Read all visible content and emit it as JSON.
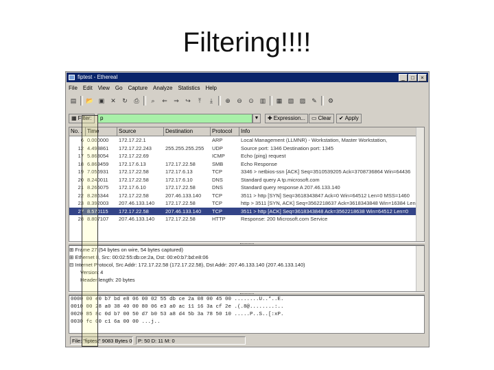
{
  "slide": {
    "title": "Filtering!!!!"
  },
  "window": {
    "title": "fiptest - Ethereal",
    "controls": [
      "_",
      "□",
      "×"
    ]
  },
  "menu": [
    "File",
    "Edit",
    "View",
    "Go",
    "Capture",
    "Analyze",
    "Statistics",
    "Help"
  ],
  "filter": {
    "label": "Filter:",
    "value": "p",
    "expression_label": "Expression...",
    "clear_label": "Clear",
    "apply_label": "Apply"
  },
  "packet_list": {
    "columns": [
      "No. .",
      "Time",
      "Source",
      "Destination",
      "Protocol",
      "Info"
    ],
    "rows": [
      [
        "6",
        "0.000000",
        "172.17.22.1",
        "",
        "ARP",
        "Local Management (LLMNR) - Workstation, Master Workstation,"
      ],
      [
        "12",
        "4.493861",
        "172.17.22.243",
        "255.255.255.255",
        "UDP",
        "Source port: 1346  Destination port: 1345"
      ],
      [
        "17",
        "5.868054",
        "172.17.22.69",
        "",
        "ICMP",
        "Echo (ping) request"
      ],
      [
        "18",
        "6.869459",
        "172.17.6.13",
        "172.17.22.58",
        "SMB",
        "Echo Response"
      ],
      [
        "19",
        "7.056931",
        "172.17.22.58",
        "172.17.6.13",
        "TCP",
        "3346 > netbios-ssn [ACK] Seq=3510539205 Ack=3708736864 Win=64436"
      ],
      [
        "20",
        "8.240011",
        "172.17.22.58",
        "172.17.6.10",
        "DNS",
        "Standard query A tp.microsoft.com"
      ],
      [
        "21",
        "8.265075",
        "172.17.6.10",
        "172.17.22.58",
        "DNS",
        "Standard query response A 207.46.133.140"
      ],
      [
        "22",
        "8.286344",
        "172.17.22.58",
        "207.46.133.140",
        "TCP",
        "3511 > http [SYN] Seq=3618343847 Ack=0 Win=64512 Len=0 MSS=1460"
      ],
      [
        "23",
        "8.392003",
        "207.46.133.140",
        "172.17.22.58",
        "TCP",
        "http > 3511 [SYN, ACK] Seq=3562218637 Ack=3618343848 Win=16384 Len"
      ],
      [
        "27",
        "8.570115",
        "172.17.22.58",
        "207.46.133.140",
        "TCP",
        "3511 > http [ACK] Seq=3618343848 Ack=3562218638 Win=64512 Len=0"
      ],
      [
        "28",
        "8.807107",
        "207.46.133.140",
        "172.17.22.58",
        "HTTP",
        "Response: 200 Microsoft.com Service"
      ]
    ],
    "selected_index": 9
  },
  "packet_tree": [
    "Frame 27 (54 bytes on wire, 54 bytes captured)",
    "Ethernet II, Src: 00:02:55:db:ce:2a, Dst: 00:e0:b7:bd:e8:06",
    "Internet Protocol, Src Addr: 172.17.22.58 (172.17.22.58), Dst Addr: 207.46.133.140 (207.46.133.140)",
    "Version: 4",
    "Header length: 20 bytes"
  ],
  "packet_bytes": [
    "0000  00 e0 b7 bd e8 06 00 02 55 db ce 2a 08 00 45 00   ........U..*..E.",
    "0010  00 28 a0 38 40 00 80 06 e3 a0 ac 11 16 3a cf 2e   .(.8@........:..",
    "0020  85 8c 0d b7 00 50 d7 b0 53 a8 d4 5b 3a 78 50 10   .....P..S..[:xP.",
    "0030  fc 00 c1 6a 00 00                                 ...j.."
  ],
  "status": {
    "left": "File: \"fiptest\" 9083 Bytes 00:00:09",
    "right": "P: 50 D: 11 M: 0"
  }
}
